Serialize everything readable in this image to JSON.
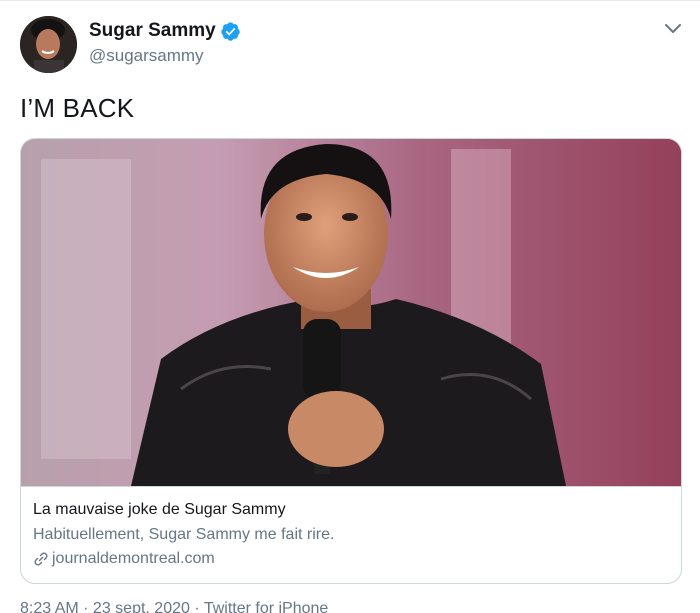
{
  "author": {
    "display_name": "Sugar Sammy",
    "handle": "@sugarsammy",
    "verified": true
  },
  "tweet": {
    "text": "I’M BACK"
  },
  "card": {
    "title": "La mauvaise joke de Sugar Sammy",
    "description": "Habituellement, Sugar Sammy me fait rire.",
    "domain": "journaldemontreal.com"
  },
  "meta": {
    "timestamp": "8:23 AM · 23 sept. 2020 · Twitter for iPhone"
  },
  "icons": {
    "verified": "verified-badge-icon",
    "caret": "chevron-down-icon",
    "link": "link-icon"
  },
  "colors": {
    "accent": "#1da1f2",
    "text_primary": "#14171a",
    "text_secondary": "#657786",
    "border": "#ccd6dd"
  }
}
